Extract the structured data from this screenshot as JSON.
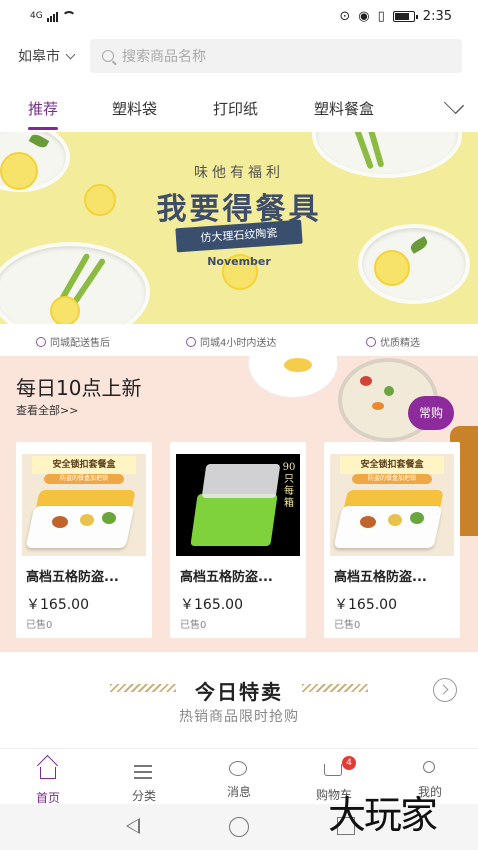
{
  "status_bar": {
    "network": "4G",
    "time": "2:35"
  },
  "header": {
    "city": "如皋市",
    "search_placeholder": "搜索商品名称"
  },
  "tabs": [
    {
      "label": "推荐",
      "active": true
    },
    {
      "label": "塑料袋",
      "active": false
    },
    {
      "label": "打印纸",
      "active": false
    },
    {
      "label": "塑料餐盒",
      "active": false
    }
  ],
  "banner": {
    "subtitle": "味他有福利",
    "title": "我要得餐具",
    "ribbon": "仿大理石纹陶瓷",
    "month": "November"
  },
  "features": [
    "同城配送售后",
    "同城4小时内送达",
    "优质精选"
  ],
  "daily": {
    "title": "每日10点上新",
    "view_all": "查看全部>>",
    "rush_button": "常购",
    "products": [
      {
        "name": "高档五格防盗...",
        "price": "￥165.00",
        "sold": "已售0",
        "image_label": "安全锁扣套餐盒",
        "image_sub": "防盗的餐盒加把锁"
      },
      {
        "name": "高档五格防盗...",
        "price": "￥165.00",
        "sold": "已售0",
        "image_label": "90只每箱"
      },
      {
        "name": "高档五格防盗...",
        "price": "￥165.00",
        "sold": "已售0",
        "image_label": "安全锁扣套餐盒",
        "image_sub": "防盗的餐盒加把锁"
      }
    ]
  },
  "today": {
    "title": "今日特卖",
    "subtitle": "热销商品限时抢购"
  },
  "bottom_nav": [
    {
      "label": "首页",
      "icon": "home-icon",
      "active": true
    },
    {
      "label": "分类",
      "icon": "category-icon",
      "active": false
    },
    {
      "label": "消息",
      "icon": "message-icon",
      "active": false
    },
    {
      "label": "购物车",
      "icon": "cart-icon",
      "active": false,
      "badge": "4"
    },
    {
      "label": "我的",
      "icon": "user-icon",
      "active": false
    }
  ],
  "watermark": "大玩家",
  "colors": {
    "accent": "#7b2d8e",
    "banner_bg": "#f3ec9a",
    "daily_bg": "#fbe4da",
    "badge": "#e53935"
  }
}
